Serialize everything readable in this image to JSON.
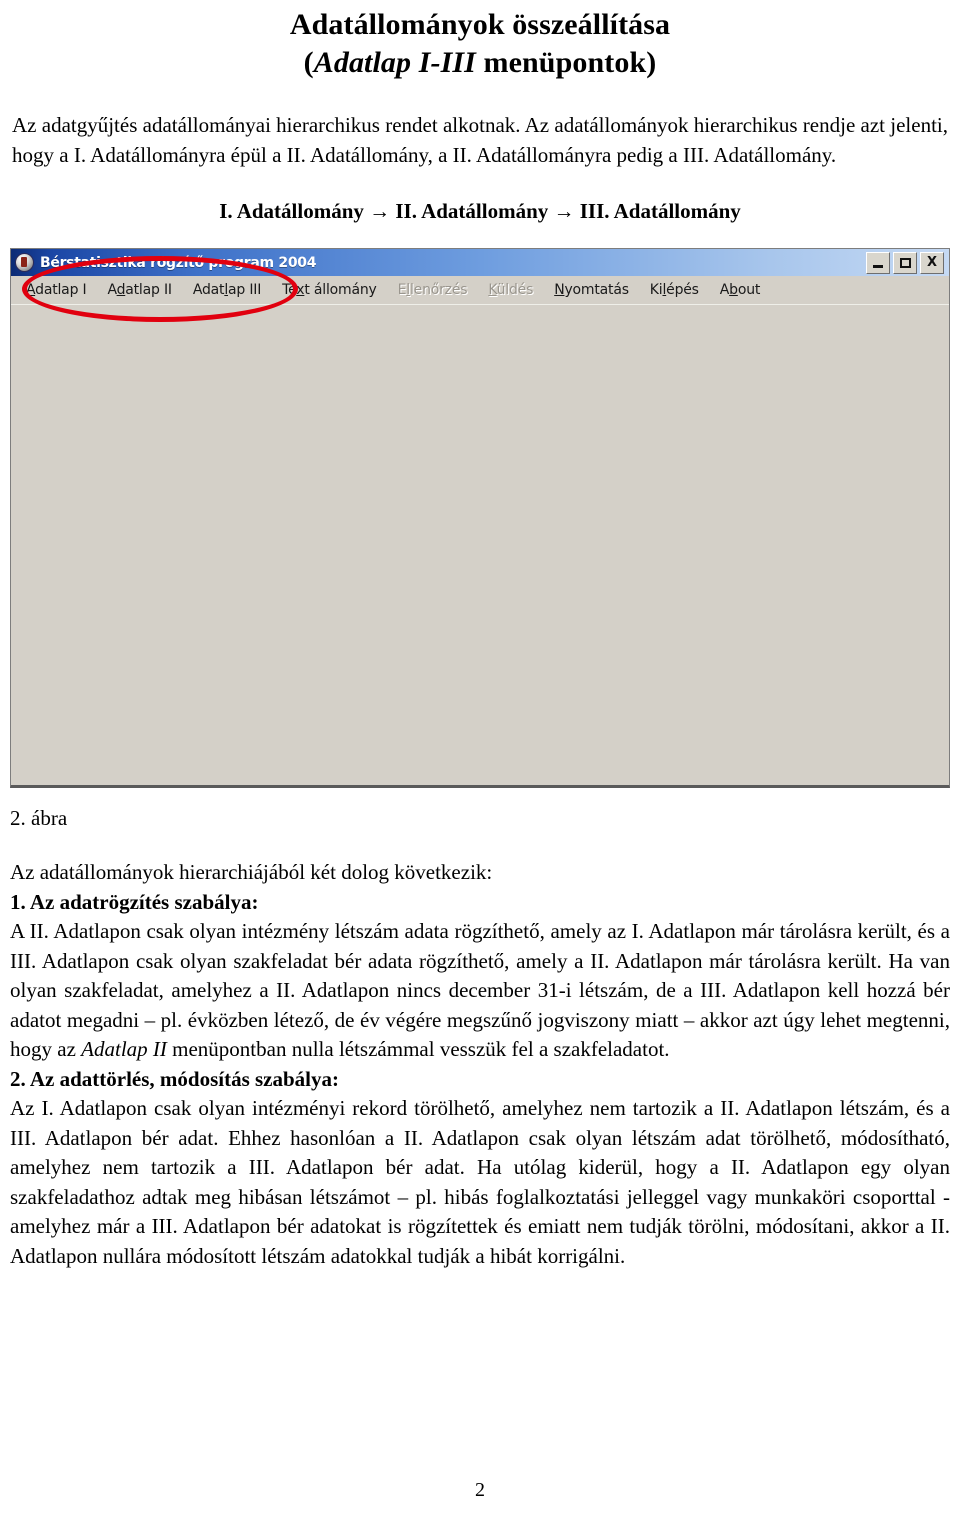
{
  "document": {
    "title_line1": "Adatállományok összeállítása",
    "title_line2_open": "(",
    "title_line2_italic": "Adatlap I-III",
    "title_line2_rest": " menüpontok)",
    "intro_paragraph": "Az adatgyűjtés adatállományai hierarchikus rendet alkotnak. Az adatállományok hierarchikus rendje azt jelenti, hogy a I. Adatállományra épül a II. Adatállomány, a II. Adatállományra pedig a III. Adatállomány.",
    "flow_line": "I. Adatállomány → II. Adatállomány → III. Adatállomány",
    "figure_caption": "2. ábra",
    "page_number": "2"
  },
  "screenshot": {
    "window": {
      "title": "Bérstatisztika rögzítő program 2004",
      "icon": "app-icon",
      "buttons": [
        {
          "name": "minimize-button",
          "label": "_"
        },
        {
          "name": "maximize-button",
          "label": "□"
        },
        {
          "name": "close-button",
          "label": "X"
        }
      ]
    },
    "menu": [
      {
        "name": "menu-adatlap-1",
        "label": "Adatlap I",
        "mnemonic": "A",
        "disabled": false,
        "highlighted": true
      },
      {
        "name": "menu-adatlap-2",
        "label": "Adatlap II",
        "mnemonic": "d",
        "disabled": false,
        "highlighted": true
      },
      {
        "name": "menu-adatlap-3",
        "label": "Adatlap III",
        "mnemonic": "l",
        "disabled": false,
        "highlighted": true
      },
      {
        "name": "menu-text-allomany",
        "label": "Text állomány",
        "mnemonic": "x",
        "disabled": false,
        "highlighted": false
      },
      {
        "name": "menu-ellenorzes",
        "label": "Ellenőrzés",
        "mnemonic": "l",
        "disabled": true,
        "highlighted": false
      },
      {
        "name": "menu-kuldes",
        "label": "Küldés",
        "mnemonic": "K",
        "disabled": true,
        "highlighted": false
      },
      {
        "name": "menu-nyomtatas",
        "label": "Nyomtatás",
        "mnemonic": "N",
        "disabled": false,
        "highlighted": false
      },
      {
        "name": "menu-kilepes",
        "label": "Kilépés",
        "mnemonic": "l",
        "disabled": false,
        "highlighted": false
      },
      {
        "name": "menu-about",
        "label": "About",
        "mnemonic": "b",
        "disabled": false,
        "highlighted": false
      }
    ],
    "annotation": {
      "shape": "ellipse",
      "color": "#e1000f",
      "encircles": "Adatlap I, Adatlap II, Adatlap III menu items"
    }
  },
  "body": {
    "lead_in": "Az adatállományok hierarchiájából két dolog következik:",
    "rule1_heading": "1. Az adatrögzítés szabálya:",
    "rule1_part_a": "A II. Adatlapon csak olyan intézmény létszám adata rögzíthető, amely az I. Adatlapon már tárolásra került, és a III. Adatlapon csak olyan szakfeladat bér adata rögzíthető, amely a II. Adatlapon már tárolásra került. Ha van olyan szakfeladat, amelyhez a II. Adatlapon nincs december 31-i létszám, de a III. Adatlapon kell hozzá bér adatot megadni – pl. évközben létező, de év végére megszűnő jogviszony miatt – akkor azt úgy lehet megtenni, hogy az ",
    "rule1_italic": "Adatlap II",
    "rule1_part_b": " menüpontban nulla létszámmal vesszük fel a szakfeladatot.",
    "rule2_heading": "2. Az adattörlés, módosítás szabálya:",
    "rule2_text": "Az I. Adatlapon csak olyan intézményi rekord törölhető, amelyhez nem tartozik a II. Adatlapon létszám, és a III. Adatlapon bér adat. Ehhez hasonlóan a II. Adatlapon csak olyan létszám adat törölhető, módosítható, amelyhez nem tartozik a III. Adatlapon bér adat. Ha utólag kiderül, hogy a II. Adatlapon egy olyan szakfeladathoz adtak meg hibásan létszámot – pl. hibás foglalkoztatási jelleggel vagy munkaköri csoporttal - amelyhez már a III. Adatlapon bér adatokat is rögzítettek és emiatt nem tudják törölni, módosítani, akkor a II. Adatlapon nullára módosított létszám adatokkal tudják a hibát korrigálni."
  }
}
